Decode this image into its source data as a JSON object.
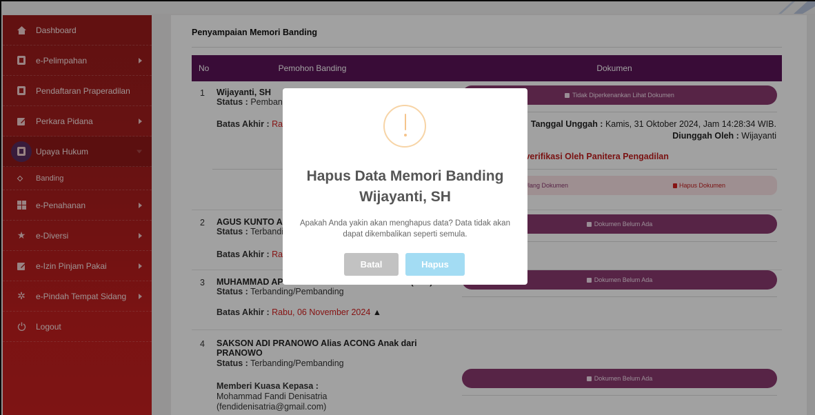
{
  "sidebar": {
    "items": [
      {
        "label": "Dashboard",
        "icon": "home-icon",
        "arrow": false
      },
      {
        "label": "e-Pelimpahan",
        "icon": "folder-icon",
        "arrow": true
      },
      {
        "label": "Pendaftaran Praperadilan",
        "icon": "folder-icon",
        "arrow": false
      },
      {
        "label": "Perkara Pidana",
        "icon": "edit-icon",
        "arrow": true
      },
      {
        "label": "Upaya Hukum",
        "icon": "folder-icon",
        "arrow": true,
        "active": true
      },
      {
        "label": "e-Penahanan",
        "icon": "grid-icon",
        "arrow": true
      },
      {
        "label": "e-Diversi",
        "icon": "star-icon",
        "arrow": true
      },
      {
        "label": "e-Izin Pinjam Pakai",
        "icon": "edit-icon",
        "arrow": true
      },
      {
        "label": "e-Pindah Tempat Sidang",
        "icon": "gear-icon",
        "arrow": true
      },
      {
        "label": "Logout",
        "icon": "power-icon",
        "arrow": false
      }
    ],
    "sub_item": "Banding"
  },
  "main": {
    "title": "Penyampaian Memori Banding",
    "headers": {
      "no": "No",
      "pemohon": "Pemohon Banding",
      "dokumen": "Dokumen"
    },
    "rows": [
      {
        "no": "1",
        "name": "Wijayanti, SH",
        "status_label": "Status :",
        "status_value": "Pembanc",
        "batas_label": "Batas Akhir :",
        "batas_value": "Rab",
        "doc_button": "Tidak Diperkenankan Lihat Dokumen",
        "upload_label": "Tanggal Unggah :",
        "upload_value": "Kamis, 31 Oktober 2024, Jam 14:28:34 WIB.",
        "uploader_label": "Diunggah Oleh :",
        "uploader_value": "Wijayanti",
        "verif": "iverifikasi Oleh Panitera Pengadilan",
        "ulang": "h Ulang Dokumen",
        "hapus_doc": "Hapus Dokumen"
      },
      {
        "no": "2",
        "name": "AGUS KUNTO AJI",
        "status_label": "Status :",
        "status_value": "Terbandi",
        "batas_label": "Batas Akhir :",
        "batas_value": "Rab",
        "doc_button": "Dokumen Belum Ada"
      },
      {
        "no": "3",
        "name": "MUHAMMAD APTA PRADIPTA Bin SUGIYANTO (Alm)",
        "status_label": "Status :",
        "status_value": "Terbanding/Pembanding",
        "batas_label": "Batas Akhir :",
        "batas_value": "Rabu, 06 November 2024",
        "doc_button": "Dokumen Belum Ada"
      },
      {
        "no": "4",
        "name_line1": "SAKSON ADI PRANOWO Alias ACONG Anak dari",
        "name_line2": "PRANOWO",
        "status_label": "Status :",
        "status_value": "Terbanding/Pembanding",
        "kuasa_label": "Memberi Kuasa Kepasa :",
        "kuasa_name": "Mohammad Fandi Denisatria",
        "kuasa_email": "(fendidenisatria@gmail.com)",
        "doc_button": "Dokumen Belum Ada"
      }
    ]
  },
  "modal": {
    "title_line1": "Hapus Data Memori Banding",
    "title_line2": "Wijayanti, SH",
    "text": "Apakah Anda yakin akan menghapus data? Data tidak akan dapat dikembalikan seperti semula.",
    "cancel": "Batal",
    "confirm": "Hapus",
    "icon": "warning-icon"
  },
  "colors": {
    "sidebar": "#a71d1d",
    "table_header": "#5b1457",
    "doc_button": "#8a3a70",
    "danger": "#d42020",
    "confirm": "#a3dcf3",
    "cancel": "#c2c2c2",
    "warning": "#f5c48b"
  }
}
